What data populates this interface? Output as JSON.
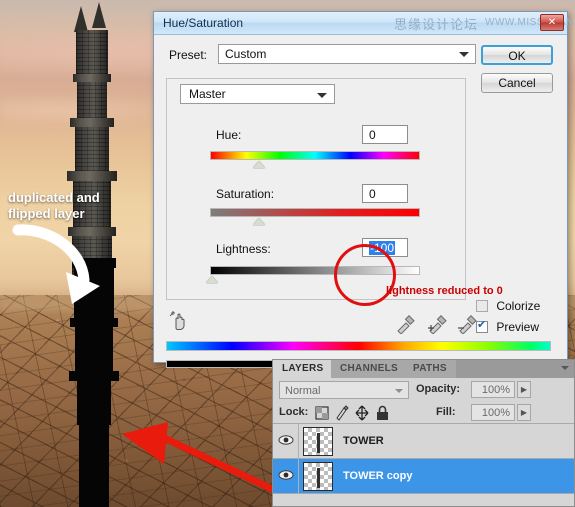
{
  "canvas": {
    "annotation_flip": "duplicated and\nflipped layer",
    "annotation_flip_line1": "duplicated and",
    "annotation_flip_line2": "flipped layer"
  },
  "dialog": {
    "title": "Hue/Saturation",
    "watermark_cn": "思缘设计论坛",
    "watermark_url": "WWW.MISSYUAN.COM",
    "close_label": "✕",
    "preset_label": "Preset:",
    "preset_value": "Custom",
    "preset_menu_icon": "preset-options-icon",
    "ok_label": "OK",
    "cancel_label": "Cancel",
    "channel_value": "Master",
    "sliders": [
      {
        "label": "Hue:",
        "value": "0",
        "selected": false,
        "thumb_pct": 50
      },
      {
        "label": "Saturation:",
        "value": "0",
        "selected": false,
        "thumb_pct": 50
      },
      {
        "label": "Lightness:",
        "value": "-100",
        "selected": true,
        "thumb_pct": 0
      }
    ],
    "hue_label": "Hue:",
    "hue_value": "0",
    "saturation_label": "Saturation:",
    "saturation_value": "0",
    "lightness_label": "Lightness:",
    "lightness_value": "-100",
    "colorize_label": "Colorize",
    "colorize_checked": false,
    "preview_label": "Preview",
    "preview_checked": true,
    "red_note": "lightness reduced to 0",
    "icons": {
      "hand": "on-image-adjust-hand-icon",
      "eyedropper": "eyedropper-icon",
      "eyedropper_plus": "eyedropper-add-icon",
      "eyedropper_minus": "eyedropper-subtract-icon"
    },
    "colors": {
      "title_bar": "#cfe6f8",
      "accent_ok_border": "#3c9fd6",
      "annotation_red": "#cc0000",
      "selection_blue": "#2f80ea"
    }
  },
  "layers_panel": {
    "tabs": [
      {
        "label": "LAYERS",
        "active": true
      },
      {
        "label": "CHANNELS",
        "active": false
      },
      {
        "label": "PATHS",
        "active": false
      }
    ],
    "blend_mode": "Normal",
    "opacity_label": "Opacity:",
    "opacity_value": "100%",
    "lock_label": "Lock:",
    "lock_icons": [
      "lock-transparent-pixels-icon",
      "lock-image-pixels-icon",
      "lock-position-icon",
      "lock-all-icon"
    ],
    "fill_label": "Fill:",
    "fill_value": "100%",
    "layers": [
      {
        "name": "TOWER",
        "visible": true,
        "selected": false
      },
      {
        "name": "TOWER copy",
        "visible": true,
        "selected": true
      }
    ],
    "colors": {
      "selected_row": "#3d95e8",
      "panel_bg": "#d6d6d6"
    }
  }
}
